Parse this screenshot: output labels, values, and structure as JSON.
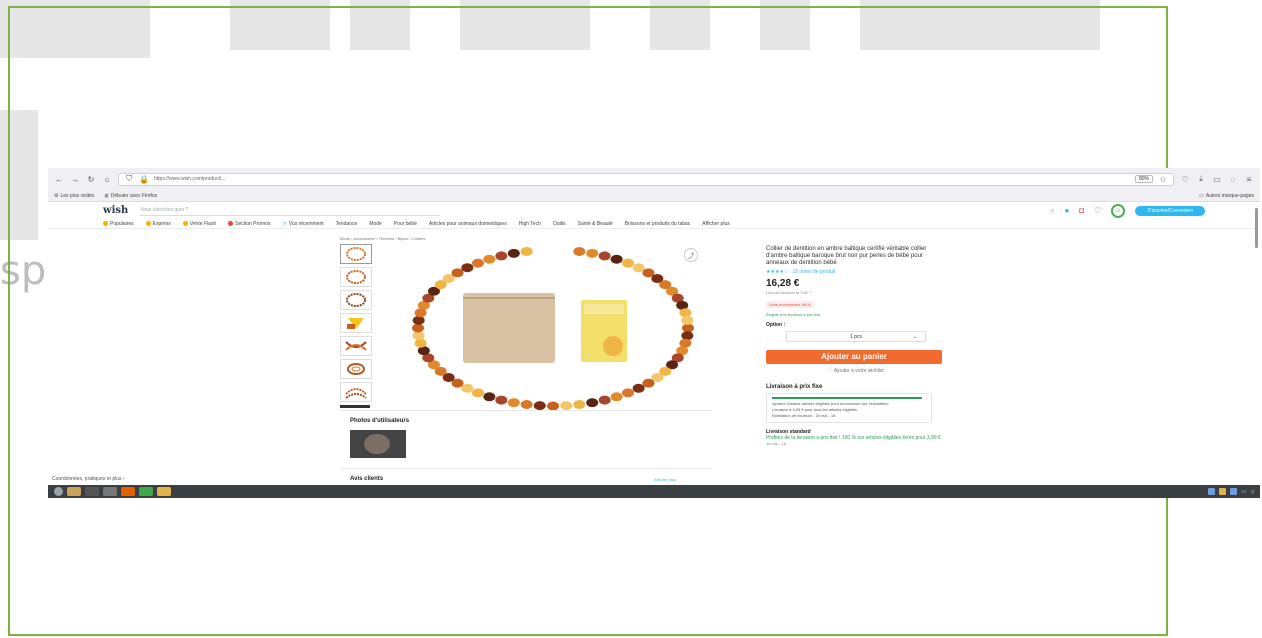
{
  "browser": {
    "url": "https://www.wish.com/product/...",
    "zoom": "80%",
    "bookmarks": [
      "Les plus visités",
      "Débuter avec Firefox"
    ],
    "other_bookmarks": "Autres marque-pages"
  },
  "site": {
    "logo": "wish",
    "search_placeholder": "Vous cherchez quoi ?",
    "signin_button": "S'inscrire/Connexion",
    "categories": [
      "Populaires",
      "Express",
      "Vente Flash",
      "Section Promos",
      "Vus récemment",
      "Tendance",
      "Mode",
      "Pour bébé",
      "Articles pour animaux domestiques",
      "High Tech",
      "Outils",
      "Santé & Beauté",
      "Boissons et produits du tabac",
      "Afficher plus"
    ]
  },
  "breadcrumb": "Mode › Accessoires › Femmes › Bijoux › Colliers",
  "product": {
    "title": "Collier de dentition en ambre baltique certifié véritable collier d'ambre baltique baroque brut noir pur perles de bébé pour anneaux de dentition bébé",
    "rating_stars": "★★★★☆",
    "reviews": "18 notes de produit",
    "price": "16,28 €",
    "price_sub": "Les prix incluent la TVA",
    "discount_badge": "Vous économisez 46 %",
    "eligible": "Éligible à la livraison à prix fixe",
    "option_label": "Option :",
    "option_value": "1 pcs",
    "add_to_cart": "Ajouter au panier",
    "add_to_wishlist": "Ajouter à votre wishlist"
  },
  "shipping": {
    "flat_title": "Livraison à prix fixe",
    "flat_line1": "Ajoutez d'autres articles éligibles pour économiser sur l'expédition",
    "flat_line2": "Livraison à 3,99 € pour tous les articles éligibles",
    "flat_est": "Estimation de livraison : 16 mai - 18",
    "std_title": "Livraison standard",
    "std_text": "Profitez de la livraison à prix fixe ! 100 % sur articles éligibles livrés pour 3,99 €",
    "std_date": "16 mai - 18"
  },
  "sections": {
    "photos": "Photos d'utilisateurs",
    "reviews": "Avis clients",
    "reviews_link": "Afficher plus"
  },
  "status_bar": "Coordonnées, pratiques et plus ›",
  "watermark": {
    "text": "sp"
  },
  "colors": {
    "accent": "#2fb7ec",
    "cart": "#f16a2e",
    "frame": "#7cb342",
    "taskbar": "#3a3f44"
  }
}
